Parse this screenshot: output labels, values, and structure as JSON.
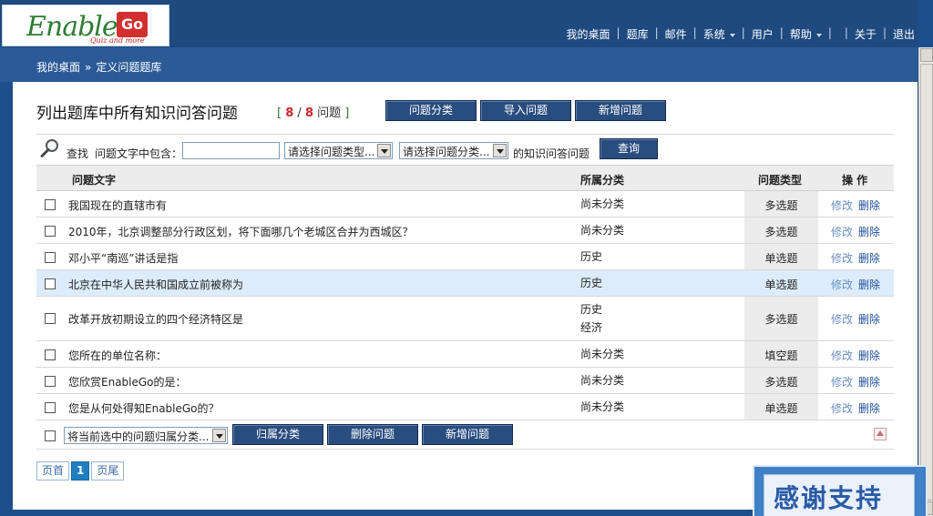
{
  "brand": {
    "logo_text": "Enable",
    "logo_go": "Go",
    "logo_sub": "Quiz and more"
  },
  "topnav": {
    "items": [
      {
        "label": "我的桌面",
        "dropdown": false
      },
      {
        "label": "题库",
        "dropdown": false
      },
      {
        "label": "邮件",
        "dropdown": false
      },
      {
        "label": "系统",
        "dropdown": true
      },
      {
        "label": "用户",
        "dropdown": false
      },
      {
        "label": "帮助",
        "dropdown": true
      },
      {
        "label": "",
        "dropdown": false
      },
      {
        "label": "关于",
        "dropdown": false
      },
      {
        "label": "退出",
        "dropdown": false
      }
    ]
  },
  "breadcrumb": {
    "home": "我的桌面",
    "arrow": "»",
    "current": "定义问题题库"
  },
  "page": {
    "title": "列出题库中所有知识问答问题",
    "count_open": "[",
    "count_shown": "8",
    "count_slash": "/",
    "count_total": "8",
    "count_unit": "问题",
    "count_close": "]",
    "buttons": {
      "category": "问题分类",
      "import": "导入问题",
      "add": "新增问题"
    }
  },
  "search": {
    "find_label": "查找",
    "contains_label": "问题文字中包含：",
    "text_value": "",
    "type_select": "请选择问题类型...",
    "category_select": "请选择问题分类...",
    "suffix": "的知识问答问题",
    "query_button": "查询"
  },
  "table": {
    "headers": {
      "text": "问题文字",
      "category": "所属分类",
      "type": "问题类型",
      "ops": "操 作"
    },
    "rows": [
      {
        "text": "我国现在的直辖市有",
        "category": [
          "尚未分类"
        ],
        "type": "多选题",
        "edit": "修改",
        "delete": "删除"
      },
      {
        "text": "2010年，北京调整部分行政区划，将下面哪几个老城区合并为西城区？",
        "category": [
          "尚未分类"
        ],
        "type": "多选题",
        "edit": "修改",
        "delete": "删除"
      },
      {
        "text": "邓小平“南巡”讲话是指",
        "category": [
          "历史"
        ],
        "type": "单选题",
        "edit": "修改",
        "delete": "删除"
      },
      {
        "text": "北京在中华人民共和国成立前被称为",
        "category": [
          "历史"
        ],
        "type": "单选题",
        "edit": "修改",
        "delete": "删除"
      },
      {
        "text": "改革开放初期设立的四个经济特区是",
        "category": [
          "历史",
          "经济"
        ],
        "type": "多选题",
        "edit": "修改",
        "delete": "删除"
      },
      {
        "text": "您所在的单位名称：",
        "category": [
          "尚未分类"
        ],
        "type": "填空题",
        "edit": "修改",
        "delete": "删除"
      },
      {
        "text": "您欣赏EnableGo的是：",
        "category": [
          "尚未分类"
        ],
        "type": "多选题",
        "edit": "修改",
        "delete": "删除"
      },
      {
        "text": "您是从何处得知EnableGo的？",
        "category": [
          "尚未分类"
        ],
        "type": "单选题",
        "edit": "修改",
        "delete": "删除"
      }
    ],
    "footer": {
      "bulk_select": "将当前选中的问题归属分类...",
      "assign_button": "归属分类",
      "delete_button": "删除问题",
      "add_button": "新增问题"
    }
  },
  "pager": {
    "first": "页首",
    "current": "1",
    "last": "页尾"
  },
  "thanks": "感谢支持"
}
